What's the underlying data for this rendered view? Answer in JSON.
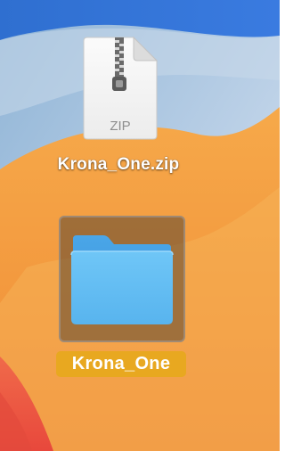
{
  "desktop": {
    "items": [
      {
        "label": "Krona_One.zip",
        "badge": "ZIP",
        "icon": "zip-archive-icon"
      },
      {
        "label": "Krona_One",
        "icon": "folder-icon"
      }
    ]
  }
}
